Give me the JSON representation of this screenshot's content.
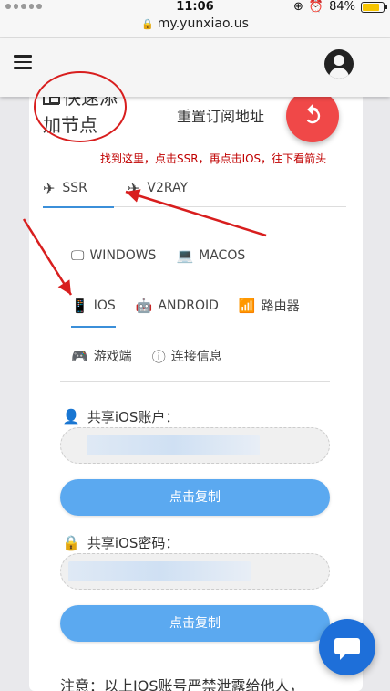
{
  "status_bar": {
    "time": "11:06",
    "battery": "84%",
    "battery_level": 0.84
  },
  "browser": {
    "url": "my.yunxiao.us"
  },
  "header": {
    "menu_icon": "hamburger-menu-icon",
    "avatar_icon": "account-circle-icon"
  },
  "card": {
    "title": "快速添加节点",
    "reset_link": "重置订阅地址",
    "refresh_icon": "refresh-icon"
  },
  "annotation": {
    "hint": "找到这里，点击SSR，再点击IOS，往下看箭头"
  },
  "protocol_tabs": [
    {
      "label": "SSR",
      "icon": "airplane-icon",
      "active": true
    },
    {
      "label": "V2RAY",
      "icon": "flight-land-icon",
      "active": false
    }
  ],
  "platform_tabs": [
    {
      "label": "WINDOWS",
      "icon": "desktop-icon"
    },
    {
      "label": "MACOS",
      "icon": "laptop-icon"
    },
    {
      "label": "IOS",
      "icon": "mobile-icon",
      "active": true
    },
    {
      "label": "ANDROID",
      "icon": "android-icon"
    },
    {
      "label": "路由器",
      "icon": "router-icon"
    },
    {
      "label": "游戏端",
      "icon": "gamepad-icon"
    },
    {
      "label": "连接信息",
      "icon": "info-icon"
    }
  ],
  "account": {
    "label": "共享iOS账户：",
    "icon": "account-box-icon",
    "copy_label": "点击复制"
  },
  "password": {
    "label": "共享iOS密码：",
    "icon": "lock-icon",
    "copy_label": "点击复制"
  },
  "notice": "注意：以上IOS账号严禁泄露给他人，",
  "chat": {
    "icon": "chat-bubble-icon"
  },
  "colors": {
    "accent": "#3b8fd9",
    "refresh": "#f04848",
    "button": "#5ba9f0",
    "hint": "#c00000",
    "chat": "#1e6fd9"
  }
}
